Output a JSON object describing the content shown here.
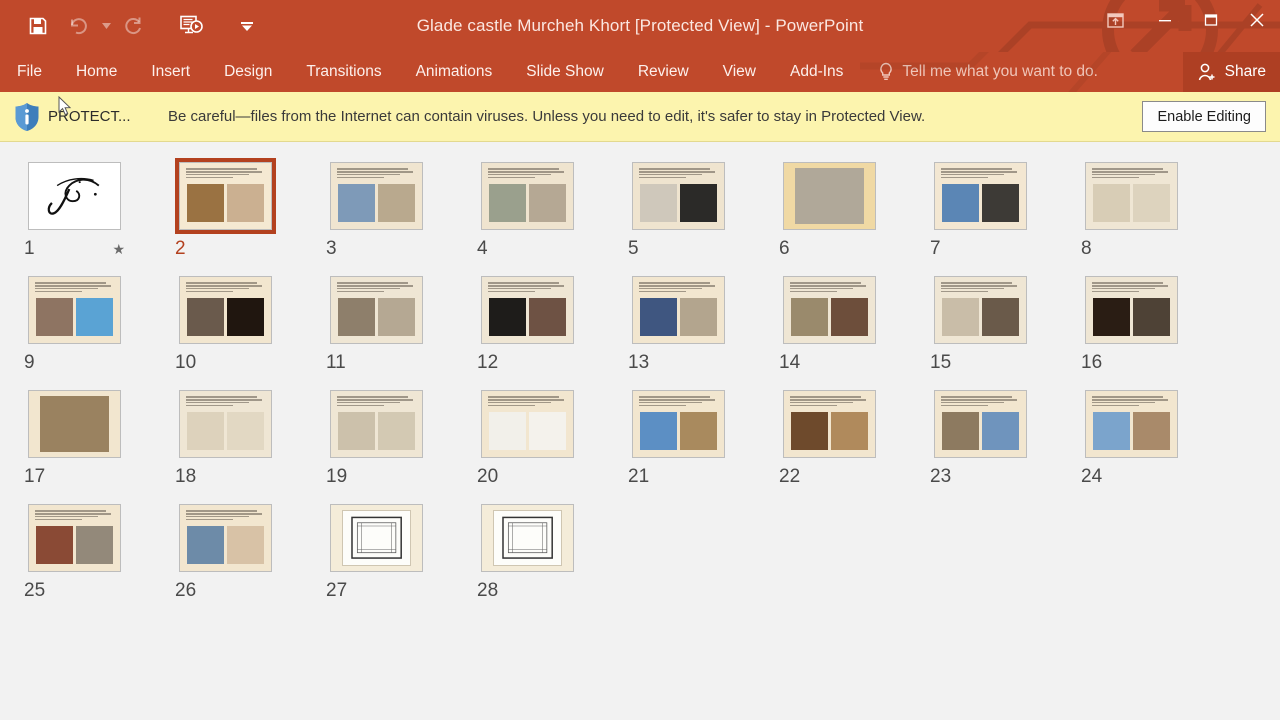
{
  "window": {
    "title": "Glade castle Murcheh Khort [Protected View] - PowerPoint",
    "accent_color": "#c0492b",
    "share_bg": "#ae3f23"
  },
  "quick_access": {
    "items": [
      {
        "name": "save-button",
        "icon": "save-icon",
        "label": "Save",
        "state": "enabled"
      },
      {
        "name": "undo-button",
        "icon": "undo-icon",
        "label": "Undo",
        "state": "disabled"
      },
      {
        "name": "undo-dropdown",
        "icon": "chevron-down-icon",
        "label": "Undo options",
        "state": "disabled"
      },
      {
        "name": "redo-button",
        "icon": "redo-icon",
        "label": "Redo",
        "state": "disabled"
      },
      {
        "name": "start-presentation-button",
        "icon": "start-from-beginning-icon",
        "label": "Start From Beginning",
        "state": "enabled"
      },
      {
        "name": "customize-qat-button",
        "icon": "chevron-down-icon",
        "label": "Customize Quick Access Toolbar",
        "state": "enabled"
      }
    ]
  },
  "window_controls": [
    {
      "name": "ribbon-display-options-button",
      "icon": "ribbon-display-options-icon",
      "label": "Ribbon Display Options",
      "glyph": ""
    },
    {
      "name": "minimize-button",
      "icon": "minimize-icon",
      "label": "Minimize",
      "glyph": "—"
    },
    {
      "name": "restore-button",
      "icon": "restore-icon",
      "label": "Restore Down",
      "glyph": "❐"
    },
    {
      "name": "close-button",
      "icon": "close-icon",
      "label": "Close",
      "glyph": "✕"
    }
  ],
  "ribbon": {
    "tabs": [
      {
        "label": "File"
      },
      {
        "label": "Home"
      },
      {
        "label": "Insert"
      },
      {
        "label": "Design"
      },
      {
        "label": "Transitions"
      },
      {
        "label": "Animations"
      },
      {
        "label": "Slide Show"
      },
      {
        "label": "Review"
      },
      {
        "label": "View"
      },
      {
        "label": "Add-Ins"
      }
    ],
    "tell_me": "Tell me what you want to do.",
    "share": "Share"
  },
  "protected_view": {
    "label": "PROTECT...",
    "message": "Be careful—files from the Internet can contain viruses. Unless you need to edit, it's safer to stay in Protected View.",
    "button": "Enable Editing",
    "bar_color": "#fcf4ae"
  },
  "slide_sorter": {
    "selected_slide": 2,
    "slide_count": 28,
    "slides": [
      {
        "number": "1",
        "kind": "calligraphy",
        "bg": "#ffffff",
        "has_animation": true,
        "img_colors": []
      },
      {
        "number": "2",
        "kind": "two-image",
        "bg": "#f5e9d2",
        "has_animation": false,
        "img_colors": [
          "#9a7242",
          "#cbb091"
        ]
      },
      {
        "number": "3",
        "kind": "two-image",
        "bg": "#f0e5d0",
        "has_animation": false,
        "img_colors": [
          "#7e9ab8",
          "#b9a98e"
        ]
      },
      {
        "number": "4",
        "kind": "two-image",
        "bg": "#efe4cf",
        "has_animation": false,
        "img_colors": [
          "#9aa08d",
          "#b5a894"
        ]
      },
      {
        "number": "5",
        "kind": "two-image",
        "bg": "#efe4cf",
        "has_animation": false,
        "img_colors": [
          "#cfc8bb",
          "#2b2a28"
        ]
      },
      {
        "number": "6",
        "kind": "full-image",
        "bg": "#f0d9a4",
        "has_animation": false,
        "img_colors": [
          "#b0a899"
        ]
      },
      {
        "number": "7",
        "kind": "two-image",
        "bg": "#f3e7d2",
        "has_animation": false,
        "img_colors": [
          "#5b86b5",
          "#3d3a36"
        ]
      },
      {
        "number": "8",
        "kind": "two-image",
        "bg": "#efe6d4",
        "has_animation": false,
        "img_colors": [
          "#d8cdb6",
          "#ddd3be"
        ]
      },
      {
        "number": "9",
        "kind": "two-image",
        "bg": "#f2e6cf",
        "has_animation": false,
        "img_colors": [
          "#8e7462",
          "#5aa3d4"
        ]
      },
      {
        "number": "10",
        "kind": "two-image",
        "bg": "#f2e6cf",
        "has_animation": false,
        "img_colors": [
          "#6a5a4c",
          "#20160f"
        ]
      },
      {
        "number": "11",
        "kind": "two-image",
        "bg": "#efe6d4",
        "has_animation": false,
        "img_colors": [
          "#8e7f6b",
          "#b5a893"
        ]
      },
      {
        "number": "12",
        "kind": "two-image",
        "bg": "#efe6d4",
        "has_animation": false,
        "img_colors": [
          "#1e1c1a",
          "#6e5244"
        ]
      },
      {
        "number": "13",
        "kind": "two-image",
        "bg": "#f2e6cf",
        "has_animation": false,
        "img_colors": [
          "#3f5680",
          "#b3a58e"
        ]
      },
      {
        "number": "14",
        "kind": "two-image",
        "bg": "#efe6d4",
        "has_animation": false,
        "img_colors": [
          "#9a8a6c",
          "#6d4e3b"
        ]
      },
      {
        "number": "15",
        "kind": "two-image",
        "bg": "#efe6d4",
        "has_animation": false,
        "img_colors": [
          "#c9bda8",
          "#6a5a4a"
        ]
      },
      {
        "number": "16",
        "kind": "two-image",
        "bg": "#efe6d4",
        "has_animation": false,
        "img_colors": [
          "#2a1d14",
          "#4e4236"
        ]
      },
      {
        "number": "17",
        "kind": "full-image",
        "bg": "#f2e6cf",
        "has_animation": false,
        "img_colors": [
          "#9a8260"
        ]
      },
      {
        "number": "18",
        "kind": "two-image",
        "bg": "#efe6d4",
        "has_animation": false,
        "img_colors": [
          "#ddd2bc",
          "#e2d8c3"
        ]
      },
      {
        "number": "19",
        "kind": "two-image",
        "bg": "#efe6d4",
        "has_animation": false,
        "img_colors": [
          "#ccc1ab",
          "#d3c9b3"
        ]
      },
      {
        "number": "20",
        "kind": "two-image",
        "bg": "#f2e6cf",
        "has_animation": false,
        "img_colors": [
          "#f2f0ea",
          "#f4f2ec"
        ]
      },
      {
        "number": "21",
        "kind": "two-image",
        "bg": "#f2e6cf",
        "has_animation": false,
        "img_colors": [
          "#5c8fc4",
          "#a98a5e"
        ]
      },
      {
        "number": "22",
        "kind": "two-image",
        "bg": "#f2e6cf",
        "has_animation": false,
        "img_colors": [
          "#6e4a2c",
          "#b08a5c"
        ]
      },
      {
        "number": "23",
        "kind": "two-image",
        "bg": "#f2e6cf",
        "has_animation": false,
        "img_colors": [
          "#8d7a60",
          "#6f94bd"
        ]
      },
      {
        "number": "24",
        "kind": "two-image",
        "bg": "#f2e6cf",
        "has_animation": false,
        "img_colors": [
          "#7ba4cc",
          "#a98a6a"
        ]
      },
      {
        "number": "25",
        "kind": "two-image",
        "bg": "#f2e6cf",
        "has_animation": false,
        "img_colors": [
          "#8a4a35",
          "#93897a"
        ]
      },
      {
        "number": "26",
        "kind": "two-image",
        "bg": "#f2e6cf",
        "has_animation": false,
        "img_colors": [
          "#6d8ba8",
          "#d8c2a6"
        ]
      },
      {
        "number": "27",
        "kind": "plan",
        "bg": "#f4ecd9",
        "has_animation": false,
        "img_colors": [
          "#ffffff"
        ]
      },
      {
        "number": "28",
        "kind": "plan",
        "bg": "#f4ecd9",
        "has_animation": false,
        "img_colors": [
          "#ffffff"
        ]
      }
    ]
  }
}
